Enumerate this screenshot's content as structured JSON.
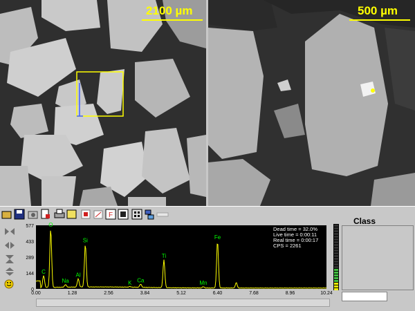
{
  "images": {
    "left_scale": "2100 µm",
    "right_scale": "500 µm"
  },
  "class_panel": {
    "title": "Class"
  },
  "spectrum": {
    "info": {
      "dead_time": "Dead time = 32.0%",
      "live_time": "Live time = 0:00:11",
      "real_time": "Real time = 0:00:17",
      "cps": "CPS = 2261"
    }
  },
  "colors": {
    "scale_text": "#ffff00",
    "trace": "#ffff00",
    "peak_label": "#00ff00",
    "roi_box": "#ffff00",
    "roi_line": "#4060ff"
  },
  "chart_data": {
    "type": "line",
    "title": "",
    "xlabel": "",
    "ylabel": "",
    "xlim": [
      0,
      10.24
    ],
    "ylim": [
      0,
      577
    ],
    "x_ticks": [
      "0.00",
      "1.28",
      "2.56",
      "3.84",
      "5.12",
      "6.40",
      "7.68",
      "8.96",
      "10.24"
    ],
    "y_ticks": [
      "0",
      "144",
      "289",
      "433",
      "577"
    ],
    "peaks": [
      {
        "label": "C",
        "x": 0.27,
        "y": 120
      },
      {
        "label": "O",
        "x": 0.52,
        "y": 545
      },
      {
        "label": "Na",
        "x": 1.04,
        "y": 38
      },
      {
        "label": "Al",
        "x": 1.49,
        "y": 90
      },
      {
        "label": "Si",
        "x": 1.74,
        "y": 405
      },
      {
        "label": "K",
        "x": 3.31,
        "y": 20
      },
      {
        "label": "Ca",
        "x": 3.69,
        "y": 42
      },
      {
        "label": "Ti",
        "x": 4.51,
        "y": 262
      },
      {
        "label": "Mn",
        "x": 5.9,
        "y": 18
      },
      {
        "label": "Fe",
        "x": 6.4,
        "y": 433
      },
      {
        "label": "",
        "x": 7.06,
        "y": 55
      }
    ]
  }
}
